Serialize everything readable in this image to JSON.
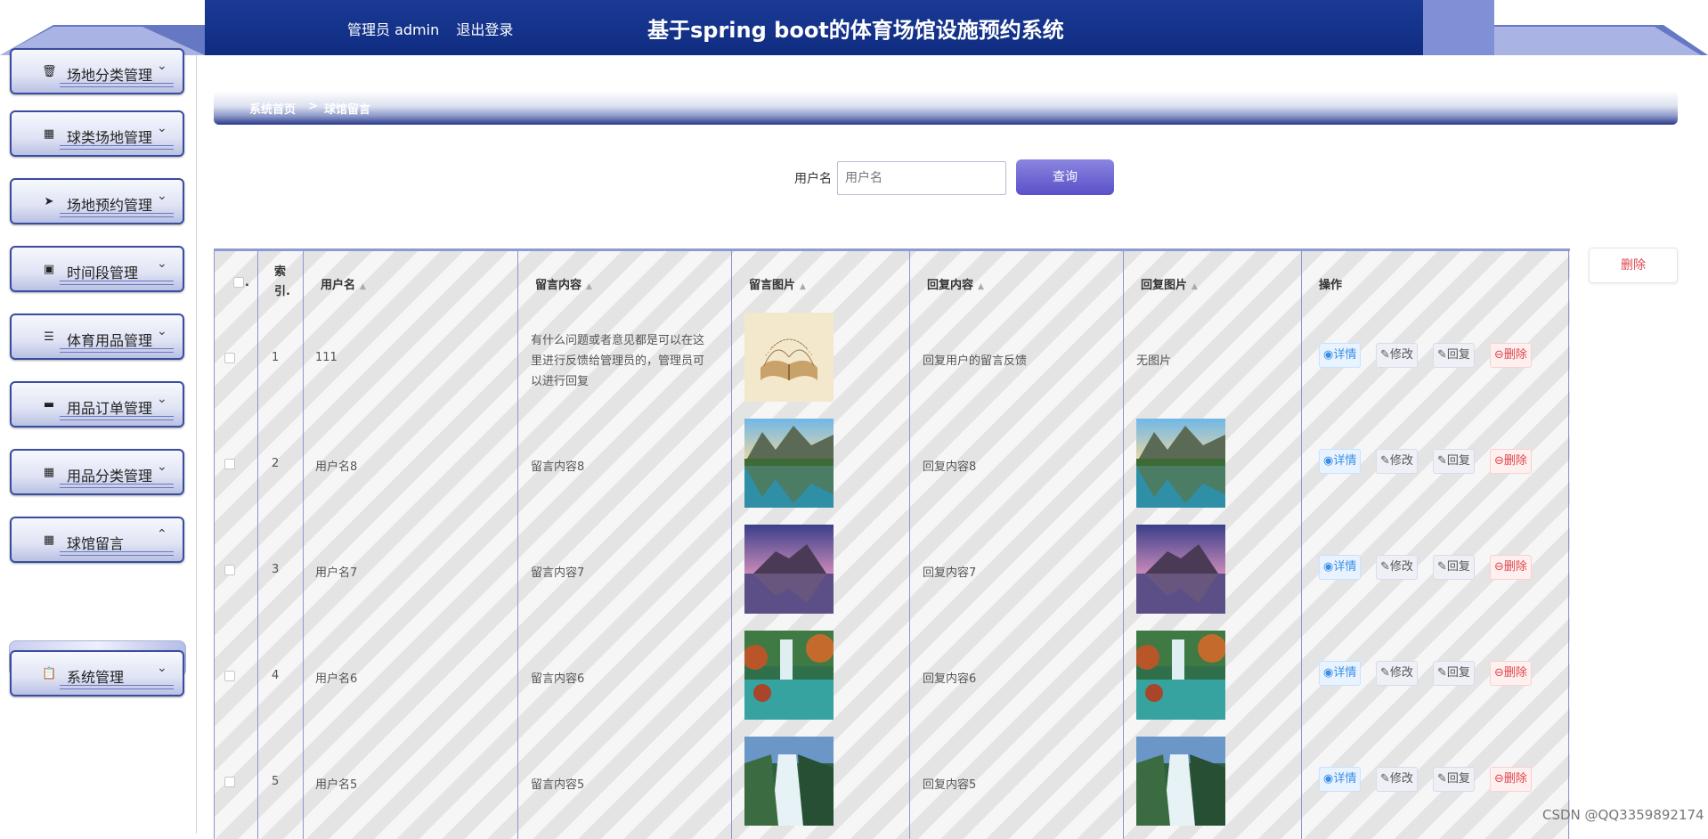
{
  "header": {
    "admin_label": "管理员 admin",
    "logout_label": "退出登录",
    "title": "基于spring boot的体育场馆设施预约系统"
  },
  "sidebar": {
    "items": [
      {
        "label": "场地分类管理",
        "icon": "trash-icon"
      },
      {
        "label": "球类场地管理",
        "icon": "grid-icon"
      },
      {
        "label": "场地预约管理",
        "icon": "send-icon"
      },
      {
        "label": "时间段管理",
        "icon": "briefcase-icon"
      },
      {
        "label": "体育用品管理",
        "icon": "list-icon"
      },
      {
        "label": "用品订单管理",
        "icon": "store-icon"
      },
      {
        "label": "用品分类管理",
        "icon": "grid-icon"
      },
      {
        "label": "球馆留言",
        "icon": "grid-icon"
      },
      {
        "label": "系统管理",
        "icon": "clipboard-icon"
      }
    ],
    "submenu": "球馆留言"
  },
  "breadcrumb": {
    "home": "系统首页",
    "sep": ">",
    "current": "球馆留言"
  },
  "search": {
    "label": "用户名",
    "placeholder": "用户名",
    "value": "",
    "button": "查询"
  },
  "batch_delete": "删除",
  "table": {
    "headers": {
      "index": "索引.",
      "username": "用户名",
      "content": "留言内容",
      "image": "留言图片",
      "reply": "回复内容",
      "reply_image": "回复图片",
      "ops": "操作"
    },
    "rows": [
      {
        "index": "1",
        "username": "111",
        "content": [
          "有什么问题或者意见都是可以在这",
          "里进行反馈给管理员的，管理员可",
          "以进行回复"
        ],
        "image": "open-book",
        "reply": "回复用户的留言反馈",
        "reply_image": "无图片"
      },
      {
        "index": "2",
        "username": "用户名8",
        "content": [
          "留言内容8"
        ],
        "image": "mountain-lake",
        "reply": "回复内容8",
        "reply_image": "mountain-lake"
      },
      {
        "index": "3",
        "username": "用户名7",
        "content": [
          "留言内容7"
        ],
        "image": "purple-lake",
        "reply": "回复内容7",
        "reply_image": "purple-lake"
      },
      {
        "index": "4",
        "username": "用户名6",
        "content": [
          "留言内容6"
        ],
        "image": "autumn-waterfall",
        "reply": "回复内容6",
        "reply_image": "autumn-waterfall"
      },
      {
        "index": "5",
        "username": "用户名5",
        "content": [
          "留言内容5"
        ],
        "image": "waterfall",
        "reply": "回复内容5",
        "reply_image": "waterfall"
      }
    ],
    "actions": {
      "detail": "详情",
      "edit": "修改",
      "reply": "回复",
      "delete": "删除"
    }
  },
  "watermark": "CSDN @QQ3359892174",
  "colors": {
    "header": "#0f2c80",
    "accent": "#5a50c8",
    "danger": "#e0454c",
    "link": "#3a8ee6"
  }
}
